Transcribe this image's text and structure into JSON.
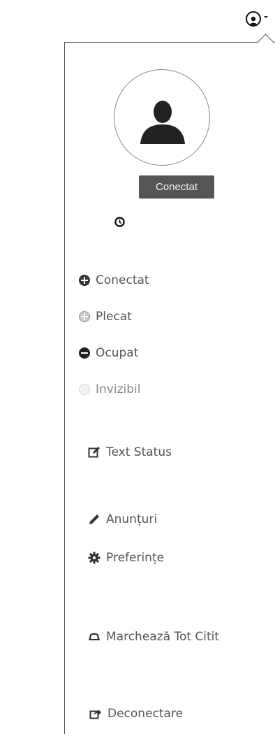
{
  "header": {
    "user_icon": "user-circle-icon",
    "caret_icon": "caret-down-icon"
  },
  "profile": {
    "avatar_icon": "user-silhouette-icon",
    "status_label": "Conectat",
    "clock_icon": "clock-icon"
  },
  "status_options": [
    {
      "label": "Conectat",
      "icon": "plus-circle-icon"
    },
    {
      "label": "Plecat",
      "icon": "plus-circle-light-icon"
    },
    {
      "label": "Ocupat",
      "icon": "minus-circle-icon"
    },
    {
      "label": "Invizibil",
      "icon": "dotted-circle-icon"
    }
  ],
  "menu": {
    "text_status": "Text Status",
    "announcements": "Anunțuri",
    "preferences": "Preferințe",
    "mark_all_read": "Marchează Tot Citit",
    "logout": "Deconectare"
  },
  "colors": {
    "pill_bg": "#555555",
    "text": "#555555"
  }
}
